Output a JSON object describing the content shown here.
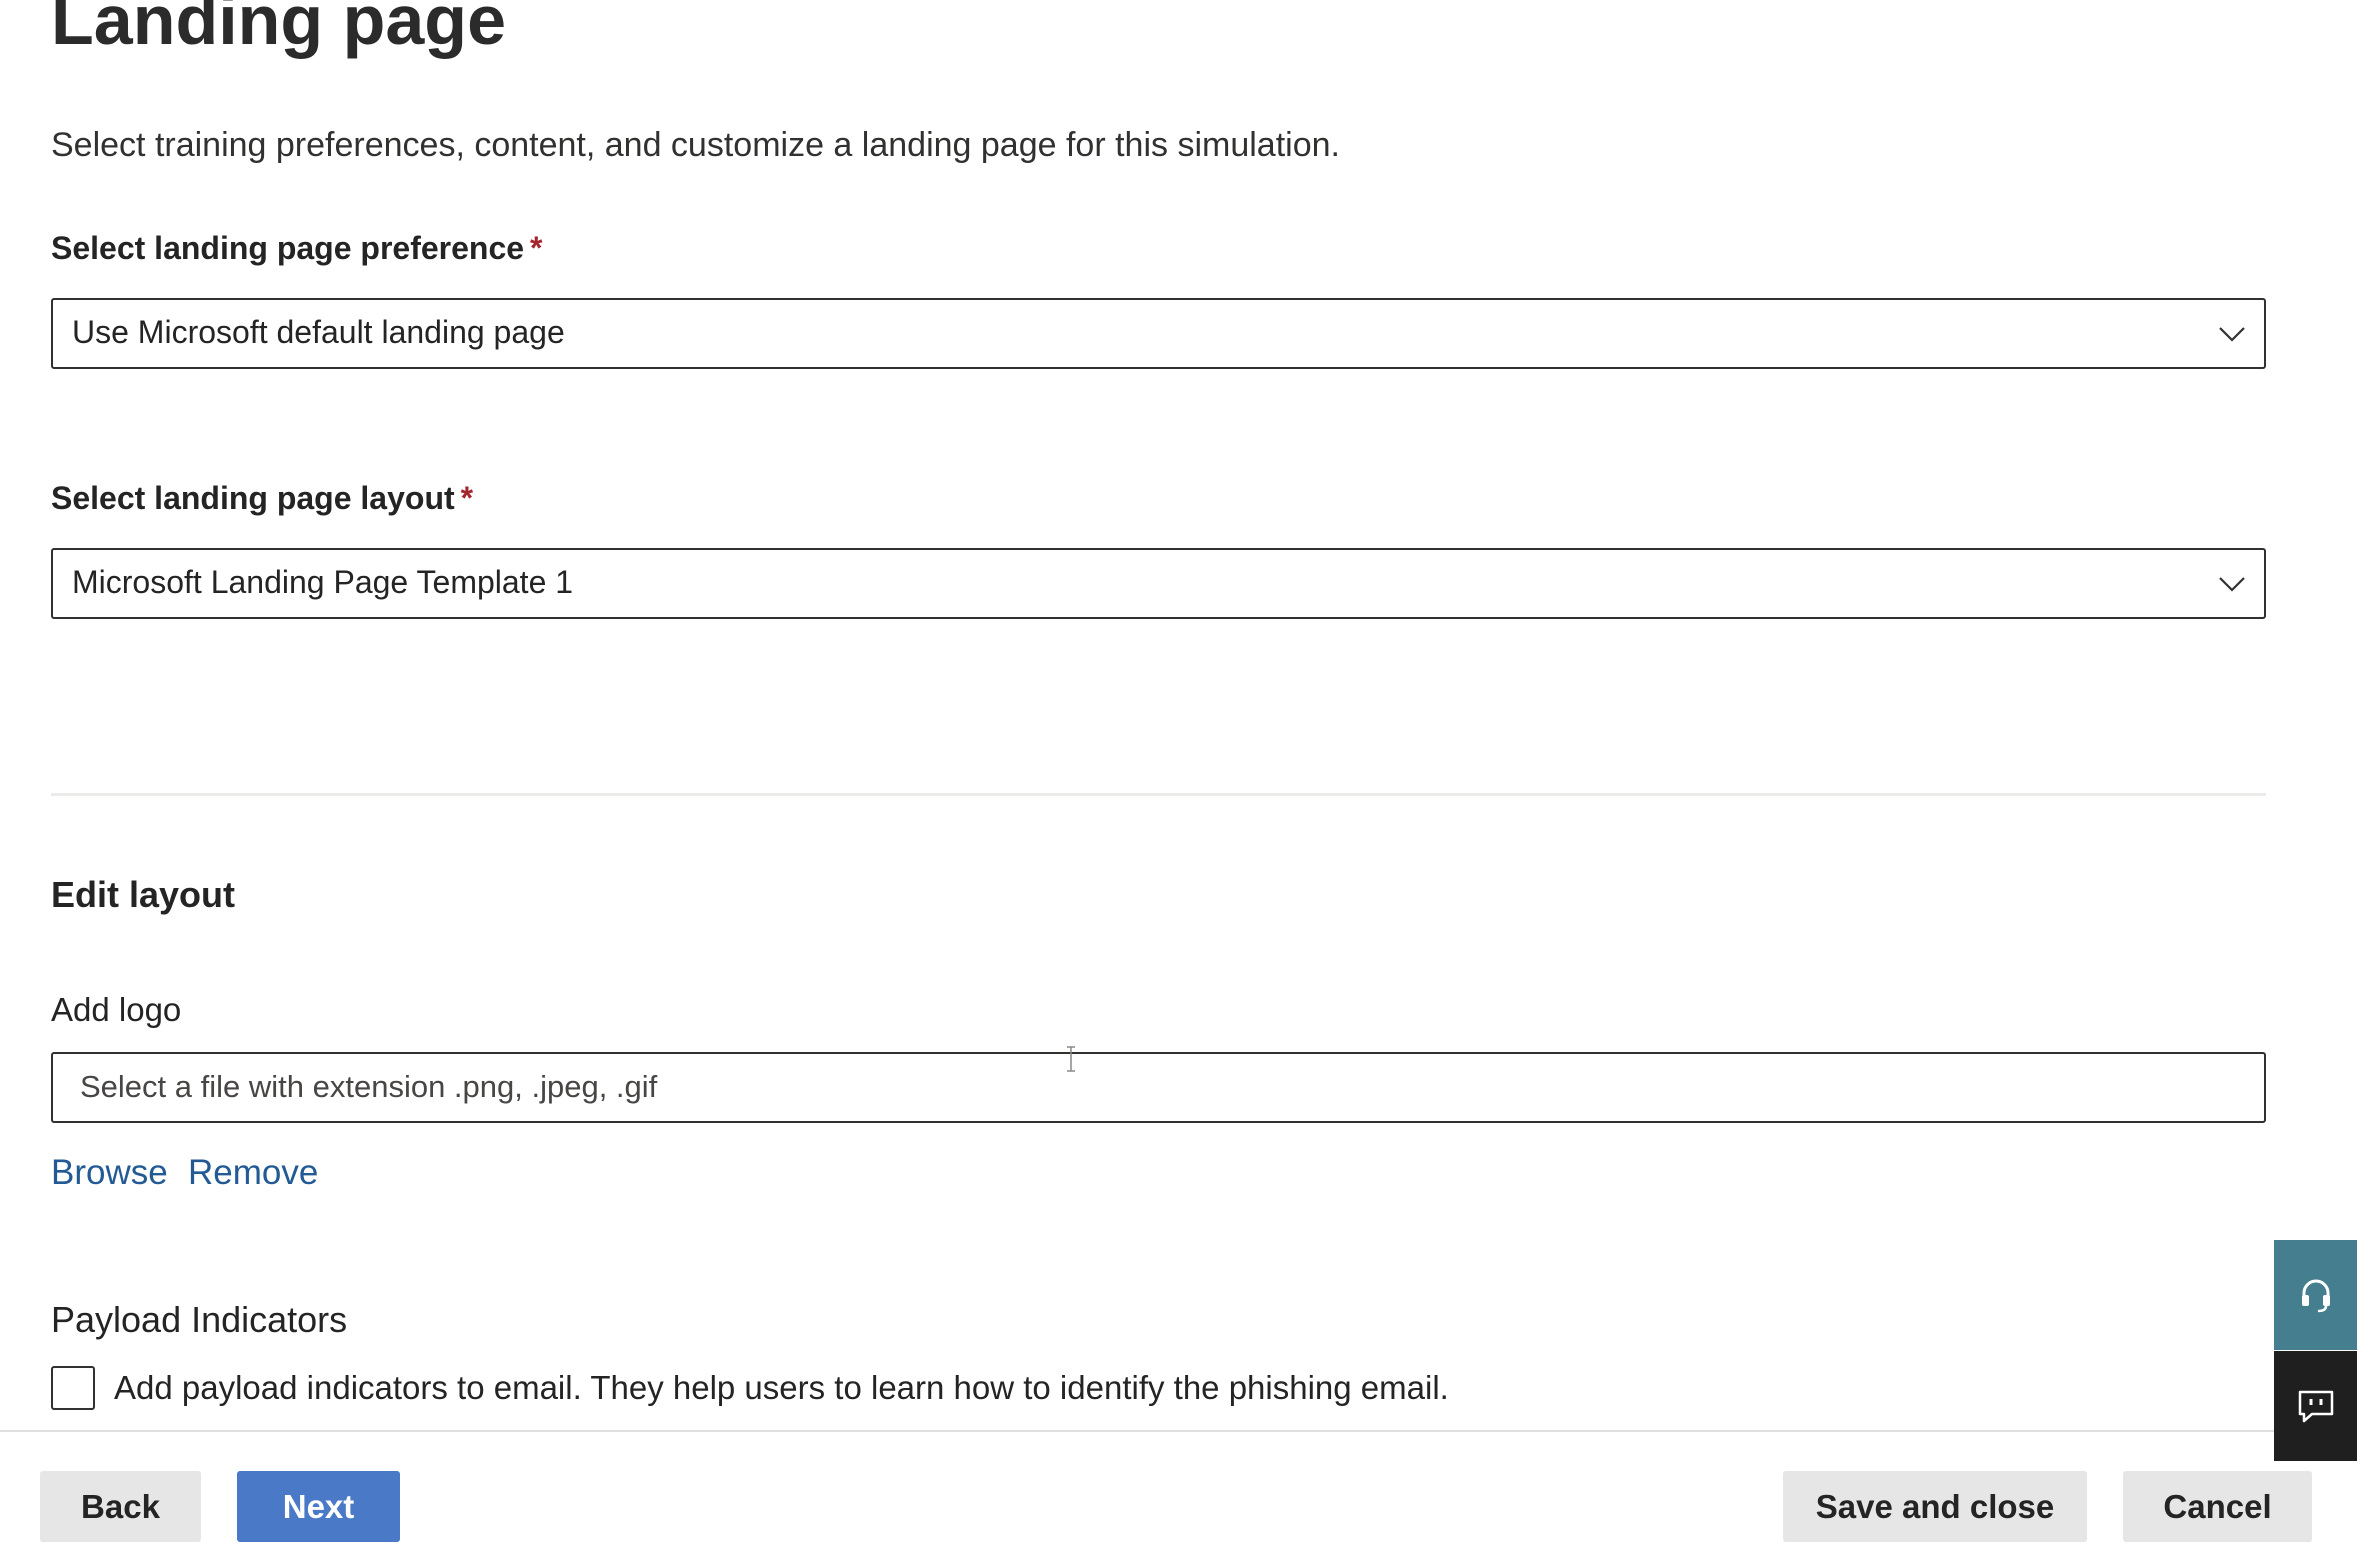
{
  "page": {
    "title": "Landing page",
    "description": "Select training preferences, content, and customize a landing page for this simulation."
  },
  "preference": {
    "label": "Select landing page preference",
    "required_mark": "*",
    "selected": "Use Microsoft default landing page"
  },
  "layout_select": {
    "label": "Select landing page layout",
    "required_mark": "*",
    "selected": "Microsoft Landing Page Template 1"
  },
  "edit_layout": {
    "heading": "Edit layout",
    "logo_label": "Add logo",
    "logo_placeholder": "Select a file with extension .png, .jpeg, .gif",
    "browse_label": "Browse",
    "remove_label": "Remove"
  },
  "payload": {
    "heading": "Payload Indicators",
    "checkbox_label": "Add payload indicators to email. They help users to learn how to identify the phishing email.",
    "checked": false
  },
  "footer": {
    "back_label": "Back",
    "next_label": "Next",
    "save_close_label": "Save and close",
    "cancel_label": "Cancel"
  },
  "side_panel": {
    "help_icon": "headset-icon",
    "feedback_icon": "feedback-icon"
  },
  "colors": {
    "primary": "#4a79c7",
    "link": "#235a94",
    "required": "#a4262c",
    "help_bg": "#457e8e",
    "feedback_bg": "#1f1f1f"
  }
}
